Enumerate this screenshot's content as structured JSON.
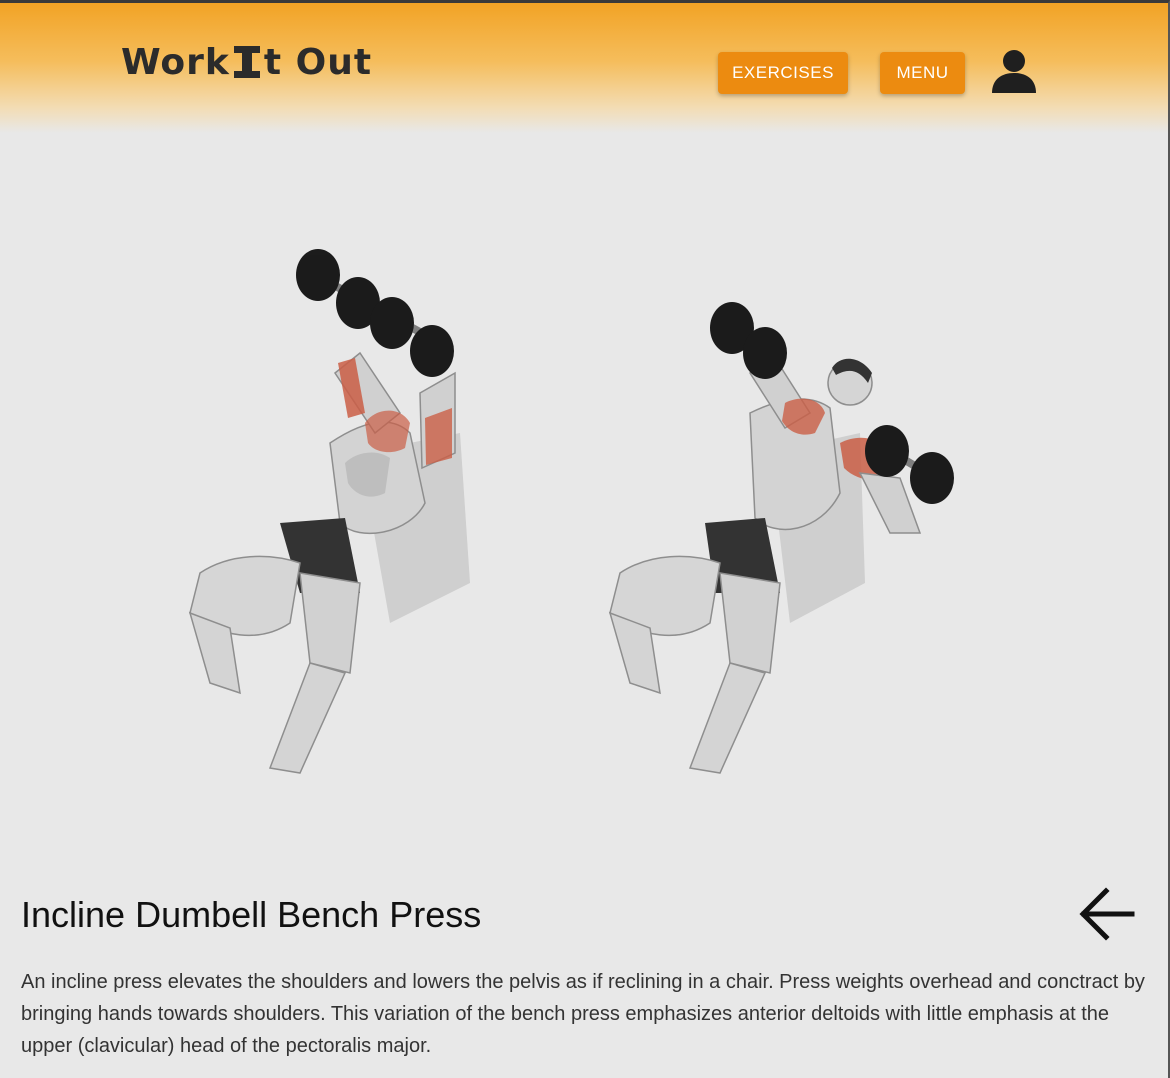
{
  "header": {
    "logo_left": "Work",
    "logo_right": "t Out",
    "nav": {
      "exercises_label": "EXERCISES",
      "menu_label": "MENU"
    },
    "user_icon": "user-icon"
  },
  "colors": {
    "accent": "#ec8b10",
    "header_gradient_top": "#f2a325",
    "background": "#e8e8e8",
    "muscle_highlight": "#c9573d"
  },
  "exercise": {
    "title": "Incline Dumbell Bench Press",
    "description": "An incline press elevates the shoulders and lowers the pelvis as if reclining in a chair. Press weights overhead and conctract by bringing hands towards shoulders. This variation of the bench press emphasizes anterior deltoids with little emphasis at the upper (clavicular) head of the pectoralis major.",
    "back_icon": "arrow-left-icon",
    "illustration": "incline-dumbbell-press-illustration"
  }
}
